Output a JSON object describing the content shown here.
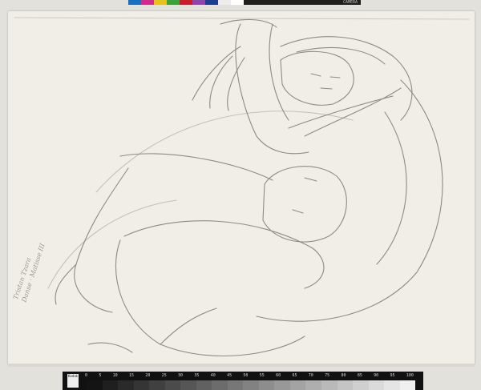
{
  "color_bar": {
    "swatches": [
      "#1c6fbf",
      "#d02a8a",
      "#e7c21b",
      "#3aa238",
      "#c81e2c",
      "#8f46a8",
      "#1d3e8f",
      "#ededed",
      "#ffffff"
    ],
    "label": "CAMERA"
  },
  "annotation": {
    "line1": "Tristan Tzara",
    "line2": "Danse · Matisse  III"
  },
  "scale": {
    "ticks": [
      "0",
      "5",
      "10",
      "15",
      "20",
      "25",
      "30",
      "35",
      "40",
      "45",
      "50",
      "55",
      "60",
      "65",
      "70",
      "75",
      "80",
      "85",
      "90",
      "95",
      "100"
    ],
    "brand": "Kodak"
  },
  "colors": {
    "paper": "#f0eee6",
    "pencil": "#8d8b84",
    "background": "#e2e1dc"
  }
}
